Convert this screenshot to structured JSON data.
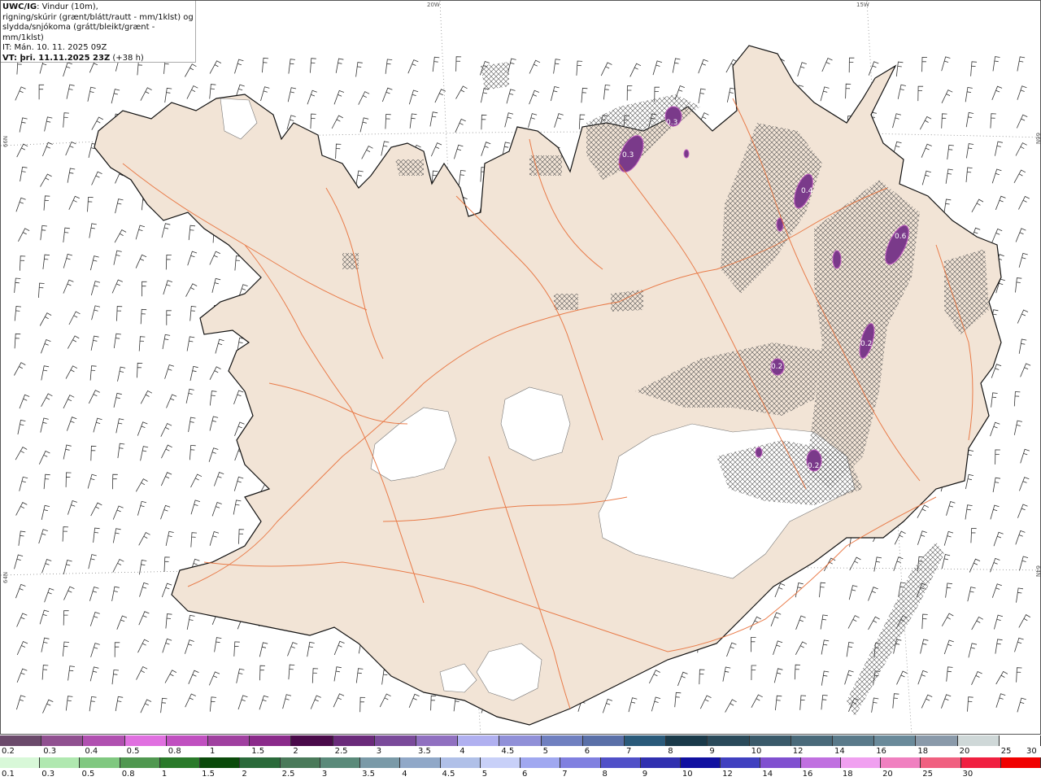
{
  "info": {
    "model": "UWC/IG",
    "line1": ": Vindur (10m),",
    "line2": "rigning/skúrir (grænt/blátt/rautt - mm/1klst) og",
    "line3": "slydda/snjókoma (grátt/bleikt/grænt - mm/1klst)",
    "it": "IT: Mán. 10. 11. 2025 09Z",
    "vt": "VT: þri. 11.11.2025 23Z",
    "vt_offset": " (+38 h)"
  },
  "grid_labels": {
    "top_20w": "20W",
    "top_15w": "15W",
    "left_66n": "66N",
    "left_64n": "64N",
    "right_66n": "66N",
    "right_64n": "64N"
  },
  "precip_values": [
    "0.3",
    "0.3",
    "0.4",
    "0.6",
    "0.2",
    "0.2",
    "0.2"
  ],
  "legend_snow": {
    "colors": [
      "#6b4a6b",
      "#905090",
      "#b050b0",
      "#e070e0",
      "#c050c0",
      "#a040a0",
      "#8a2a8a",
      "#4a0a4a",
      "#6a2a7a",
      "#7a4a9a",
      "#9070c0",
      "#b0b0f0",
      "#9090d8",
      "#7080c0",
      "#5a70a8",
      "#2a5a7a",
      "#1a3a4a",
      "#2a4a5a",
      "#3a5a6a",
      "#4a6a7a",
      "#5a7a8a",
      "#6a8a9a",
      "#8a9aaa",
      "#cfd8d8",
      "#ffffff"
    ],
    "labels": [
      "0.2",
      "0.3",
      "0.4",
      "0.5",
      "0.8",
      "1",
      "1.5",
      "2",
      "2.5",
      "3",
      "3.5",
      "4",
      "4.5",
      "5",
      "6",
      "7",
      "8",
      "9",
      "10",
      "12",
      "14",
      "16",
      "18",
      "20",
      "25",
      "30"
    ]
  },
  "legend_rain": {
    "colors": [
      "#d8f8d8",
      "#b0e8b0",
      "#80c880",
      "#509850",
      "#2a7a2a",
      "#0a4a0a",
      "#2a6a3a",
      "#4a7a5a",
      "#5a8a7a",
      "#7a9aa8",
      "#90a8c8",
      "#b0c0e8",
      "#c8d0f8",
      "#a0a8f0",
      "#8080e0",
      "#5050c8",
      "#3030b0",
      "#1010a0",
      "#4040c0",
      "#8050d0",
      "#c070e0",
      "#f0a0f0",
      "#f080c0",
      "#f06080",
      "#f02040",
      "#f00000"
    ],
    "labels": [
      "0.1",
      "0.3",
      "0.5",
      "0.8",
      "1",
      "1.5",
      "2",
      "2.5",
      "3",
      "3.5",
      "4",
      "4.5",
      "5",
      "6",
      "7",
      "8",
      "9",
      "10",
      "12",
      "14",
      "16",
      "18",
      "20",
      "25",
      "30"
    ]
  }
}
